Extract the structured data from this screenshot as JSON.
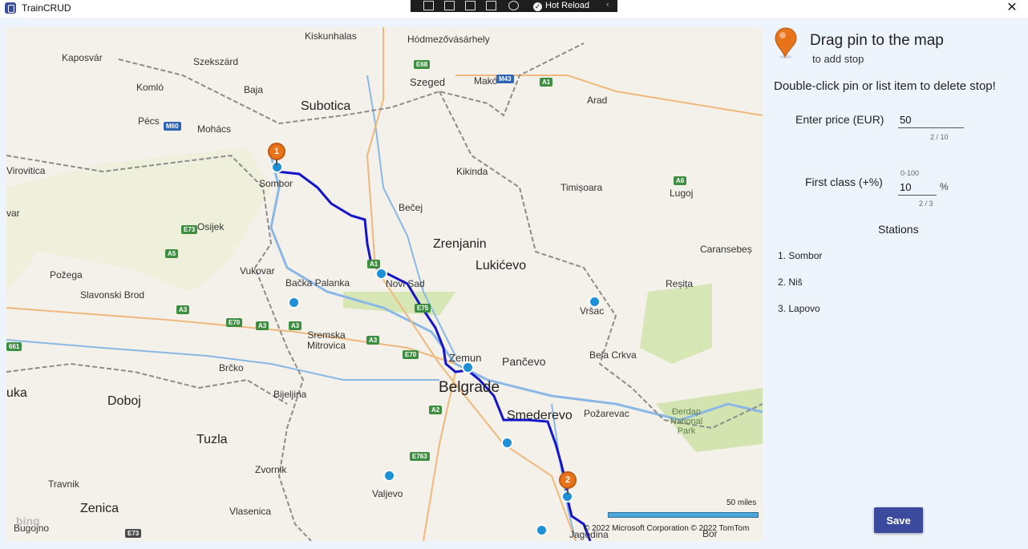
{
  "app": {
    "title": "TrainCRUD",
    "close_label": "✕"
  },
  "debug_toolbar": {
    "hot_reload_label": "Hot Reload",
    "chevron": "‹"
  },
  "map": {
    "labels": {
      "kiskunhalas": "Kiskunhalas",
      "hodmezovasarhely": "Hódmezővásárhely",
      "kaposvar": "Kaposvár",
      "szekszard": "Szekszárd",
      "szeged": "Szeged",
      "mako": "Makó",
      "komlo": "Komló",
      "baja": "Baja",
      "arad": "Arad",
      "subotica": "Subotica",
      "pecs": "Pécs",
      "mohacs": "Mohács",
      "virovitica": "Virovitica",
      "sombor": "Sombor",
      "kikinda": "Kikinda",
      "timisoara": "Timișoara",
      "lugoj": "Lugoj",
      "var": "var",
      "becej": "Bečej",
      "osijek": "Osijek",
      "zrenjanin": "Zrenjanin",
      "lukicevo": "Lukićevo",
      "caransebes": "Caransebeș",
      "pozega": "Požega",
      "vukovar": "Vukovar",
      "backa_palanka": "Bačka Palanka",
      "novi_sad": "Novi Sad",
      "resita": "Reșița",
      "slavonski_brod": "Slavonski Brod",
      "vrsac": "Vršac",
      "sremska_mitrovica": "Sremska Mitrovica",
      "zemun": "Zemun",
      "pancevo": "Pančevo",
      "bela_crkva": "Bela Crkva",
      "brcko": "Brčko",
      "belgrade": "Belgrade",
      "tuzla_left": "uka",
      "doboj": "Doboj",
      "bijeljina": "Bijeljina",
      "smederevo": "Smederevo",
      "pozarevac": "Požarevac",
      "tuzla": "Tuzla",
      "zvornik": "Zvornik",
      "travnik": "Travnik",
      "valjevo": "Valjevo",
      "zenica": "Zenica",
      "vlasenica": "Vlasenica",
      "bugojno": "Bugojno",
      "jagodina": "Jagodina",
      "bor": "Bor",
      "derdap": "Đerdap National Park"
    },
    "shields": {
      "e68": "E68",
      "m43": "M43",
      "a1": "A1",
      "m60": "M60",
      "a6": "A6",
      "e73": "E73",
      "a5": "A5",
      "a3a": "A3",
      "e70a": "E70",
      "a3b": "A3",
      "a3c": "A3",
      "a3d": "A3",
      "e70b": "E70",
      "661": "661",
      "a2": "A2",
      "e763": "E763",
      "e75": "E75",
      "e73b": "E73",
      "a1b": "A1"
    },
    "pins": {
      "first": "1",
      "second": "2"
    },
    "scale_label": "50 miles",
    "copyright": "© 2022 Microsoft Corporation    © 2022 TomTom",
    "bing_logo": "bing"
  },
  "panel": {
    "drag_title": "Drag pin to the map",
    "drag_subtitle": "to add stop",
    "hint": "Double-click pin or list item to delete stop!",
    "price": {
      "label": "Enter price (EUR)",
      "value": "50",
      "counter": "2 / 10"
    },
    "first_class": {
      "label": "First class (+%)",
      "range_hint": "0-100",
      "value": "10",
      "suffix": "%",
      "counter": "2 / 3"
    },
    "stations_header": "Stations",
    "stations": [
      "1. Sombor",
      "2. Niš",
      "3. Lapovo"
    ],
    "save_label": "Save"
  },
  "colors": {
    "route": "#1414c8",
    "pin": "#e8731a",
    "station": "#1e90d8",
    "save_button": "#3b4a9c"
  }
}
